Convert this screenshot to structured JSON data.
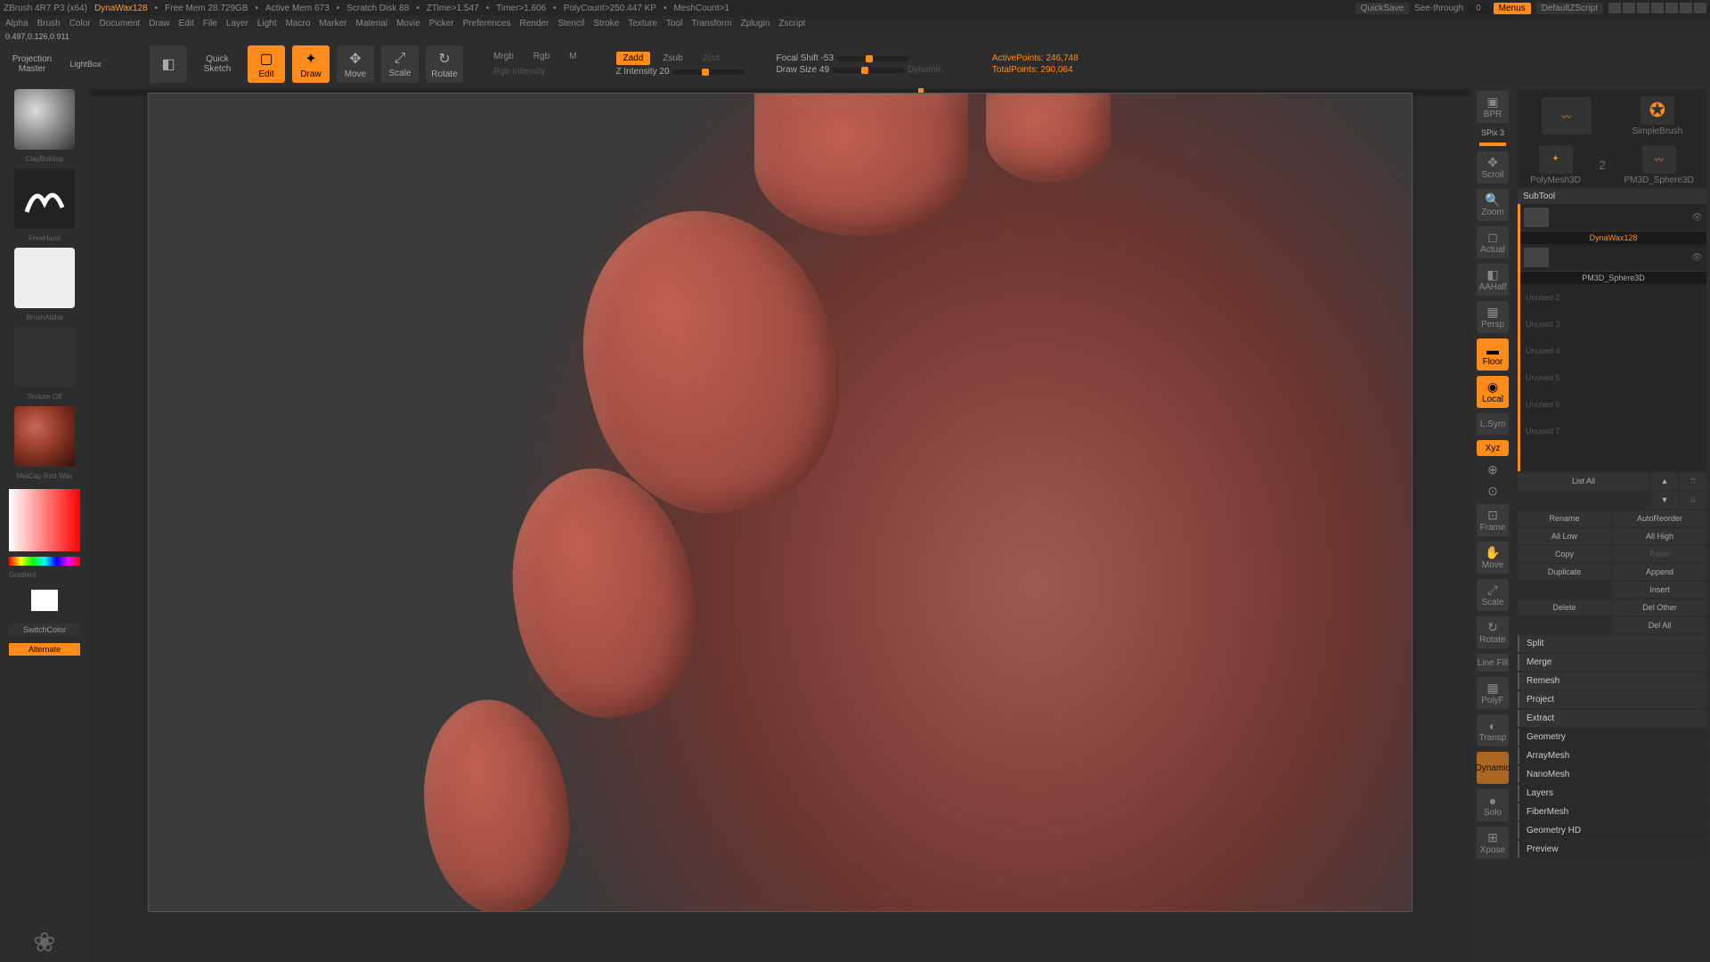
{
  "title": {
    "app": "ZBrush 4R7 P3 (x64)",
    "brush": "DynaWax128",
    "mem": "Free Mem 28.729GB",
    "amem": "Active Mem 673",
    "scratch": "Scratch Disk 88",
    "ztime": "ZTime>1.547",
    "timer": "Timer>1.606",
    "poly": "PolyCount>250.447 KP",
    "mesh": "MeshCount>1"
  },
  "topbtns": {
    "quicksave": "QuickSave",
    "seethrough": "See-through",
    "seeval": "0",
    "menus": "Menus",
    "script": "DefaultZScript"
  },
  "menu": [
    "Alpha",
    "Brush",
    "Color",
    "Document",
    "Draw",
    "Edit",
    "File",
    "Layer",
    "Light",
    "Macro",
    "Marker",
    "Material",
    "Movie",
    "Picker",
    "Preferences",
    "Render",
    "Stencil",
    "Stroke",
    "Texture",
    "Tool",
    "Transform",
    "Zplugin",
    "Zscript"
  ],
  "coords": "0.497,0.126,0.911",
  "tb": {
    "projmaster1": "Projection",
    "projmaster2": "Master",
    "lightbox": "LightBox",
    "quick": "Quick",
    "sketch": "Sketch",
    "edit": "Edit",
    "draw": "Draw",
    "move": "Move",
    "scale": "Scale",
    "rotate": "Rotate",
    "mrgb": "Mrgb",
    "rgb": "Rgb",
    "m": "M",
    "rgbint": "Rgb Intensity",
    "zadd": "Zadd",
    "zsub": "Zsub",
    "zcut": "Zcut",
    "zint": "Z Intensity 20",
    "focal": "Focal Shift -53",
    "drawsize": "Draw Size 49",
    "dynamic": "Dynamic",
    "activepts": "ActivePoints:",
    "activeval": "246,748",
    "totalpts": "TotalPoints:",
    "totalval": "290,064"
  },
  "left": {
    "brush": "ClayBuildup",
    "stroke": "FreeHand",
    "alpha": "BrushAlpha",
    "texture": "Texture Off",
    "material": "MatCap Red Wax",
    "gradient": "Gradient",
    "switch": "SwitchColor",
    "alt": "Alternate"
  },
  "ric": {
    "bph": "BPR",
    "spix": "SPix 3",
    "scroll": "Scroll",
    "zoom": "Zoom",
    "actual": "Actual",
    "aahalf": "AAHalf",
    "persp": "Persp",
    "floor": "Floor",
    "local": "Local",
    "lsym": "L.Sym",
    "xyz": "Xyz",
    "frame": "Frame",
    "move": "Move",
    "scale": "Scale",
    "rotate": "Rotate",
    "linefill": "Line Fill",
    "polyf": "PolyF",
    "transp": "Transp",
    "dynamic": "Dynamic",
    "solo": "Solo",
    "xpose": "Xpose",
    "dpersp": "Dynamic"
  },
  "rp": {
    "simplebrush": "SimpleBrush",
    "polymesh": "PolyMesh3D",
    "pm3d": "PM3D_Sphere3D",
    "subtool": "SubTool",
    "st1": "DynaWax128",
    "st2": "PM3D_Sphere3D",
    "listall": "List All",
    "rename": "Rename",
    "autoreorder": "AutoReorder",
    "alllow": "All Low",
    "allhigh": "All High",
    "copy": "Copy",
    "paste": "Paste",
    "duplicate": "Duplicate",
    "append": "Append",
    "insert": "Insert",
    "delete": "Delete",
    "delother": "Del Other",
    "delall": "Del All",
    "split": "Split",
    "merge": "Merge",
    "remesh": "Remesh",
    "project": "Project",
    "extract": "Extract",
    "geometry": "Geometry",
    "arraymesh": "ArrayMesh",
    "nanomesh": "NanoMesh",
    "layers": "Layers",
    "fibermesh": "FiberMesh",
    "geomhd": "Geometry HD",
    "preview": "Preview"
  },
  "empty": [
    "Unused 2",
    "Unused 3",
    "Unused 4",
    "Unused 5",
    "Unused 6",
    "Unused 7"
  ]
}
